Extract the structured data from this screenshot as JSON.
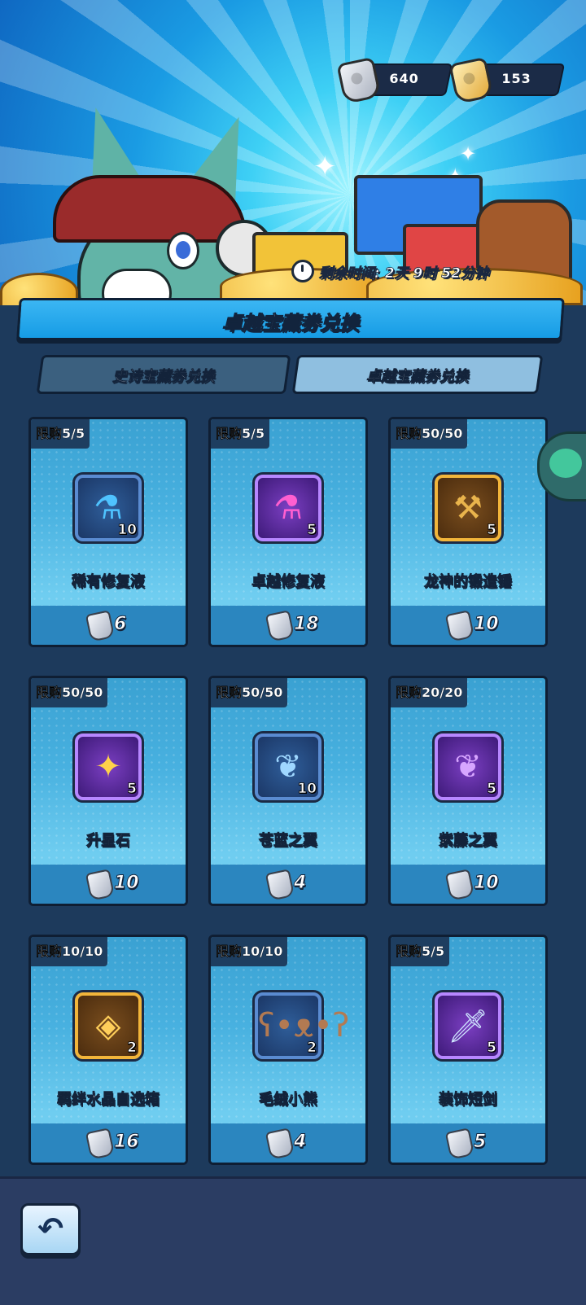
{
  "currency": {
    "silver_amount": "640",
    "gold_amount": "153"
  },
  "banner": {
    "timer_text": "剩余时间: 2天 9时 52分钟"
  },
  "title": "卓越宝藏券兑换",
  "tabs": [
    {
      "label": "史诗宝藏券兑换",
      "active": false
    },
    {
      "label": "卓越宝藏券兑换",
      "active": true
    }
  ],
  "items": [
    {
      "limit": "限购5/5",
      "name": "稀有修复液",
      "qty": "10",
      "cost": "6",
      "icon": "blue-potion-icon"
    },
    {
      "limit": "限购5/5",
      "name": "卓越修复液",
      "qty": "5",
      "cost": "18",
      "icon": "pink-potion-icon"
    },
    {
      "limit": "限购50/50",
      "name": "龙神的锻造锤",
      "qty": "5",
      "cost": "10",
      "icon": "forge-hammer-icon"
    },
    {
      "limit": "限购50/50",
      "name": "升星石",
      "qty": "5",
      "cost": "10",
      "icon": "star-stone-icon"
    },
    {
      "limit": "限购50/50",
      "name": "苍蓝之翼",
      "qty": "10",
      "cost": "4",
      "icon": "blue-feather-icon"
    },
    {
      "limit": "限购20/20",
      "name": "紫藤之翼",
      "qty": "5",
      "cost": "10",
      "icon": "purple-feather-icon"
    },
    {
      "limit": "限购10/10",
      "name": "羁绊水晶自选箱",
      "qty": "2",
      "cost": "16",
      "icon": "crystal-chest-icon"
    },
    {
      "limit": "限购10/10",
      "name": "毛绒小熊",
      "qty": "2",
      "cost": "4",
      "icon": "teddy-bear-icon"
    },
    {
      "limit": "限购5/5",
      "name": "装饰短剑",
      "qty": "5",
      "cost": "5",
      "icon": "short-sword-icon"
    }
  ],
  "colors": {
    "tab_active": "#8fbfe0",
    "tab_inactive": "#3b607f",
    "card_bg": "#48b1e0",
    "limit_badge": "#1e3e60",
    "footer": "#2b3d63"
  }
}
